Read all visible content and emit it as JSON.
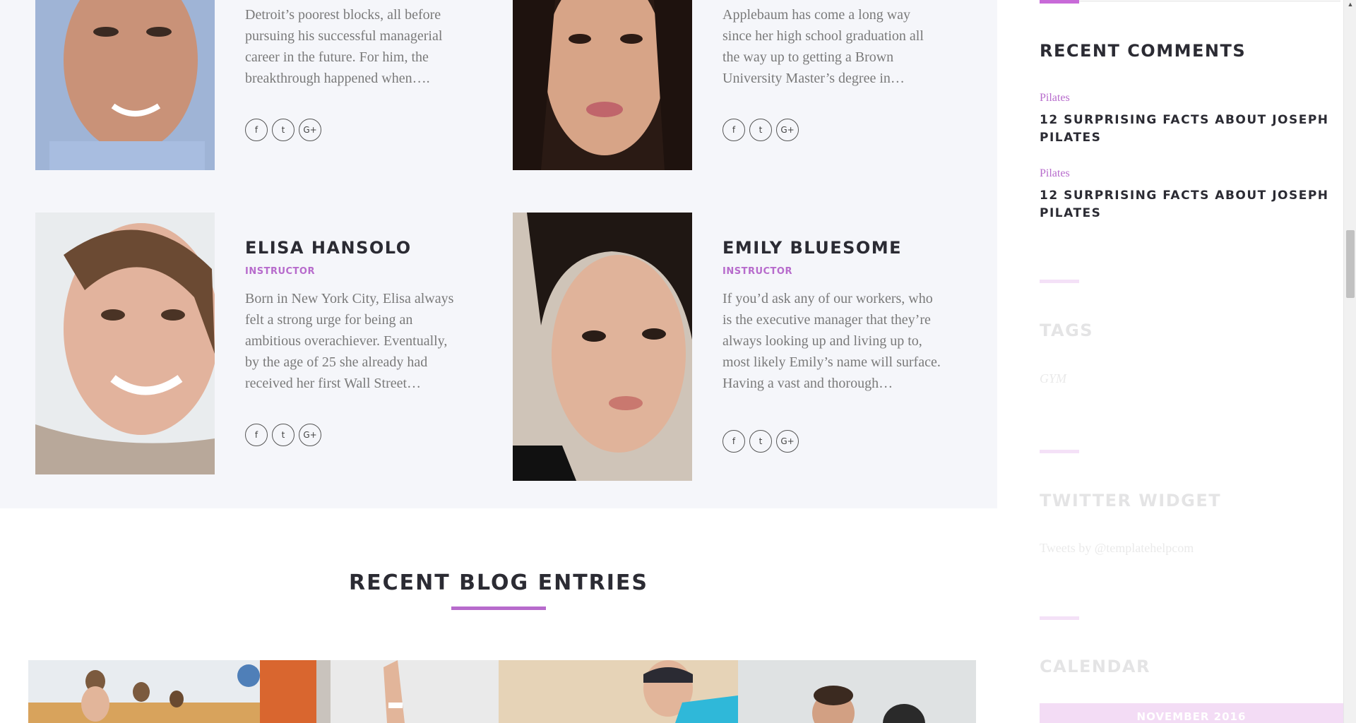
{
  "team": {
    "members": [
      {
        "name": "",
        "role": "",
        "bio": "Detroit’s poorest blocks, all before pursuing his successful managerial career in the future. For him, the breakthrough happened when….",
        "socials": [
          "f",
          "t",
          "G+"
        ]
      },
      {
        "name": "",
        "role": "",
        "bio": "Applebaum has come a long way since her high school graduation all the way up to getting a Brown University Master’s degree in…",
        "socials": [
          "f",
          "t",
          "G+"
        ]
      },
      {
        "name": "ELISA HANSOLO",
        "role": "INSTRUCTOR",
        "bio": "Born in New York City, Elisa always felt a strong urge for being an ambitious overachiever. Eventually, by the age of 25 she already had received her first Wall Street…",
        "socials": [
          "f",
          "t",
          "G+"
        ]
      },
      {
        "name": "EMILY BLUESOME",
        "role": "INSTRUCTOR",
        "bio": "If you’d ask any of our workers, who is the executive manager that they’re always looking up and living up to, most likely Emily’s name will surface. Having a vast and thorough…",
        "socials": [
          "f",
          "t",
          "G+"
        ]
      }
    ]
  },
  "blog": {
    "title": "RECENT BLOG ENTRIES"
  },
  "sidebar": {
    "recent_comments": {
      "heading": "RECENT COMMENTS",
      "items": [
        {
          "category": "Pilates",
          "title": "12 SURPRISING FACTS ABOUT JOSEPH PILATES"
        },
        {
          "category": "Pilates",
          "title": "12 SURPRISING FACTS ABOUT JOSEPH PILATES"
        }
      ]
    },
    "tags": {
      "heading": "TAGS",
      "items": [
        "GYM"
      ]
    },
    "twitter": {
      "heading": "TWITTER WIDGET",
      "text": "Tweets by @templatehelpcom"
    },
    "calendar": {
      "heading": "CALENDAR",
      "month": "NOVEMBER 2016"
    }
  },
  "colors": {
    "accent": "#b76bcc",
    "team_background": "#f5f6fa",
    "heading": "#2b2b33",
    "body_text": "#7a7a7a"
  },
  "icons": {
    "facebook": "facebook-icon",
    "twitter": "twitter-icon",
    "google_plus": "google-plus-icon"
  }
}
